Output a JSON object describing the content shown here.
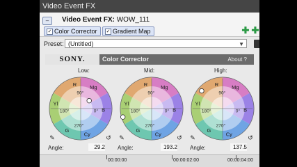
{
  "window": {
    "title": "Video Event FX"
  },
  "chain": {
    "label_bold": "Video Event FX:",
    "label_value": " WOW_111",
    "plugins": [
      "Color Corrector",
      "Gradient Map"
    ]
  },
  "preset": {
    "label": "Preset:",
    "value": "(Untitled)"
  },
  "header": {
    "brand": "SONY.",
    "title": "Color Corrector",
    "about": "About ?"
  },
  "wheel_labels": {
    "r": "R",
    "mg": "Mg",
    "b": "B",
    "yl": "Yl",
    "g": "G",
    "cy": "Cy",
    "d90": "90°",
    "d180": "180°",
    "d0": "0°",
    "d270": "270°"
  },
  "wheels": [
    {
      "label": "Low:",
      "angle_label": "Angle:",
      "angle": "29.2"
    },
    {
      "label": "Mid:",
      "angle_label": "Angle:",
      "angle": "193.2"
    },
    {
      "label": "High:",
      "angle_label": "Angle:",
      "angle": "137.5"
    }
  ],
  "timeline": {
    "timecodes": [
      "00:00:00",
      "00:00:02:00",
      "00:00:04:00"
    ]
  },
  "colors": {
    "titlebar": "#454545",
    "panel_header": "#6b6b6b",
    "chip": "#dbe4f6",
    "plug_green": "#2c9a46"
  }
}
